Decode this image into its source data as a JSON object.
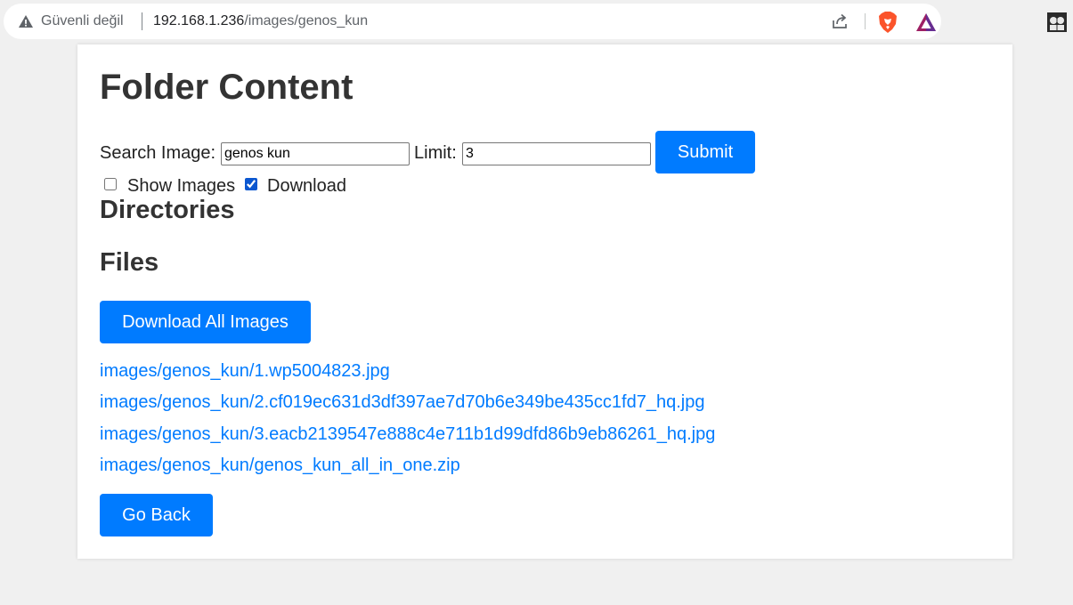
{
  "browser": {
    "security_label": "Güvenli değil",
    "url_host": "192.168.1.236",
    "url_path": "/images/genos_kun"
  },
  "page": {
    "title": "Folder Content",
    "search": {
      "label": "Search Image:",
      "value": "genos kun"
    },
    "limit": {
      "label": "Limit:",
      "value": "3"
    },
    "submit_label": "Submit",
    "show_images": {
      "label": "Show Images",
      "checked": false
    },
    "download": {
      "label": "Download",
      "checked": true
    },
    "directories_heading": "Directories",
    "files_heading": "Files",
    "download_all_label": "Download All Images",
    "files": [
      "images/genos_kun/1.wp5004823.jpg",
      "images/genos_kun/2.cf019ec631d3df397ae7d70b6e349be435cc1fd7_hq.jpg",
      "images/genos_kun/3.eacb2139547e888c4e711b1d99dfd86b9eb86261_hq.jpg",
      "images/genos_kun/genos_kun_all_in_one.zip"
    ],
    "go_back_label": "Go Back"
  },
  "colors": {
    "accent": "#007bff",
    "page_bg": "#f0f0f0",
    "card_bg": "#ffffff",
    "heading": "#333333"
  },
  "icons": {
    "security": "warning-triangle-icon",
    "share": "share-icon",
    "brave": "brave-lion-icon",
    "rewards": "brave-rewards-icon",
    "profile": "profile-avatar-icon"
  }
}
